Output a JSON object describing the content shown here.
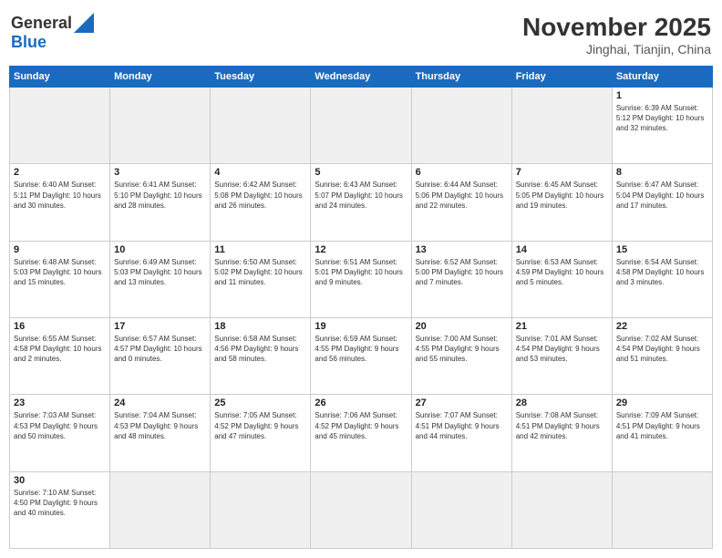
{
  "header": {
    "logo_general": "General",
    "logo_blue": "Blue",
    "title": "November 2025",
    "subtitle": "Jinghai, Tianjin, China"
  },
  "weekdays": [
    "Sunday",
    "Monday",
    "Tuesday",
    "Wednesday",
    "Thursday",
    "Friday",
    "Saturday"
  ],
  "weeks": [
    [
      {
        "day": "",
        "info": "",
        "empty": true
      },
      {
        "day": "",
        "info": "",
        "empty": true
      },
      {
        "day": "",
        "info": "",
        "empty": true
      },
      {
        "day": "",
        "info": "",
        "empty": true
      },
      {
        "day": "",
        "info": "",
        "empty": true
      },
      {
        "day": "",
        "info": "",
        "empty": true
      },
      {
        "day": "1",
        "info": "Sunrise: 6:39 AM\nSunset: 5:12 PM\nDaylight: 10 hours\nand 32 minutes.",
        "empty": false
      }
    ],
    [
      {
        "day": "2",
        "info": "Sunrise: 6:40 AM\nSunset: 5:11 PM\nDaylight: 10 hours\nand 30 minutes.",
        "empty": false
      },
      {
        "day": "3",
        "info": "Sunrise: 6:41 AM\nSunset: 5:10 PM\nDaylight: 10 hours\nand 28 minutes.",
        "empty": false
      },
      {
        "day": "4",
        "info": "Sunrise: 6:42 AM\nSunset: 5:08 PM\nDaylight: 10 hours\nand 26 minutes.",
        "empty": false
      },
      {
        "day": "5",
        "info": "Sunrise: 6:43 AM\nSunset: 5:07 PM\nDaylight: 10 hours\nand 24 minutes.",
        "empty": false
      },
      {
        "day": "6",
        "info": "Sunrise: 6:44 AM\nSunset: 5:06 PM\nDaylight: 10 hours\nand 22 minutes.",
        "empty": false
      },
      {
        "day": "7",
        "info": "Sunrise: 6:45 AM\nSunset: 5:05 PM\nDaylight: 10 hours\nand 19 minutes.",
        "empty": false
      },
      {
        "day": "8",
        "info": "Sunrise: 6:47 AM\nSunset: 5:04 PM\nDaylight: 10 hours\nand 17 minutes.",
        "empty": false
      }
    ],
    [
      {
        "day": "9",
        "info": "Sunrise: 6:48 AM\nSunset: 5:03 PM\nDaylight: 10 hours\nand 15 minutes.",
        "empty": false
      },
      {
        "day": "10",
        "info": "Sunrise: 6:49 AM\nSunset: 5:03 PM\nDaylight: 10 hours\nand 13 minutes.",
        "empty": false
      },
      {
        "day": "11",
        "info": "Sunrise: 6:50 AM\nSunset: 5:02 PM\nDaylight: 10 hours\nand 11 minutes.",
        "empty": false
      },
      {
        "day": "12",
        "info": "Sunrise: 6:51 AM\nSunset: 5:01 PM\nDaylight: 10 hours\nand 9 minutes.",
        "empty": false
      },
      {
        "day": "13",
        "info": "Sunrise: 6:52 AM\nSunset: 5:00 PM\nDaylight: 10 hours\nand 7 minutes.",
        "empty": false
      },
      {
        "day": "14",
        "info": "Sunrise: 6:53 AM\nSunset: 4:59 PM\nDaylight: 10 hours\nand 5 minutes.",
        "empty": false
      },
      {
        "day": "15",
        "info": "Sunrise: 6:54 AM\nSunset: 4:58 PM\nDaylight: 10 hours\nand 3 minutes.",
        "empty": false
      }
    ],
    [
      {
        "day": "16",
        "info": "Sunrise: 6:55 AM\nSunset: 4:58 PM\nDaylight: 10 hours\nand 2 minutes.",
        "empty": false
      },
      {
        "day": "17",
        "info": "Sunrise: 6:57 AM\nSunset: 4:57 PM\nDaylight: 10 hours\nand 0 minutes.",
        "empty": false
      },
      {
        "day": "18",
        "info": "Sunrise: 6:58 AM\nSunset: 4:56 PM\nDaylight: 9 hours\nand 58 minutes.",
        "empty": false
      },
      {
        "day": "19",
        "info": "Sunrise: 6:59 AM\nSunset: 4:55 PM\nDaylight: 9 hours\nand 56 minutes.",
        "empty": false
      },
      {
        "day": "20",
        "info": "Sunrise: 7:00 AM\nSunset: 4:55 PM\nDaylight: 9 hours\nand 55 minutes.",
        "empty": false
      },
      {
        "day": "21",
        "info": "Sunrise: 7:01 AM\nSunset: 4:54 PM\nDaylight: 9 hours\nand 53 minutes.",
        "empty": false
      },
      {
        "day": "22",
        "info": "Sunrise: 7:02 AM\nSunset: 4:54 PM\nDaylight: 9 hours\nand 51 minutes.",
        "empty": false
      }
    ],
    [
      {
        "day": "23",
        "info": "Sunrise: 7:03 AM\nSunset: 4:53 PM\nDaylight: 9 hours\nand 50 minutes.",
        "empty": false
      },
      {
        "day": "24",
        "info": "Sunrise: 7:04 AM\nSunset: 4:53 PM\nDaylight: 9 hours\nand 48 minutes.",
        "empty": false
      },
      {
        "day": "25",
        "info": "Sunrise: 7:05 AM\nSunset: 4:52 PM\nDaylight: 9 hours\nand 47 minutes.",
        "empty": false
      },
      {
        "day": "26",
        "info": "Sunrise: 7:06 AM\nSunset: 4:52 PM\nDaylight: 9 hours\nand 45 minutes.",
        "empty": false
      },
      {
        "day": "27",
        "info": "Sunrise: 7:07 AM\nSunset: 4:51 PM\nDaylight: 9 hours\nand 44 minutes.",
        "empty": false
      },
      {
        "day": "28",
        "info": "Sunrise: 7:08 AM\nSunset: 4:51 PM\nDaylight: 9 hours\nand 42 minutes.",
        "empty": false
      },
      {
        "day": "29",
        "info": "Sunrise: 7:09 AM\nSunset: 4:51 PM\nDaylight: 9 hours\nand 41 minutes.",
        "empty": false
      }
    ],
    [
      {
        "day": "30",
        "info": "Sunrise: 7:10 AM\nSunset: 4:50 PM\nDaylight: 9 hours\nand 40 minutes.",
        "empty": false
      },
      {
        "day": "",
        "info": "",
        "empty": true
      },
      {
        "day": "",
        "info": "",
        "empty": true
      },
      {
        "day": "",
        "info": "",
        "empty": true
      },
      {
        "day": "",
        "info": "",
        "empty": true
      },
      {
        "day": "",
        "info": "",
        "empty": true
      },
      {
        "day": "",
        "info": "",
        "empty": true
      }
    ]
  ]
}
